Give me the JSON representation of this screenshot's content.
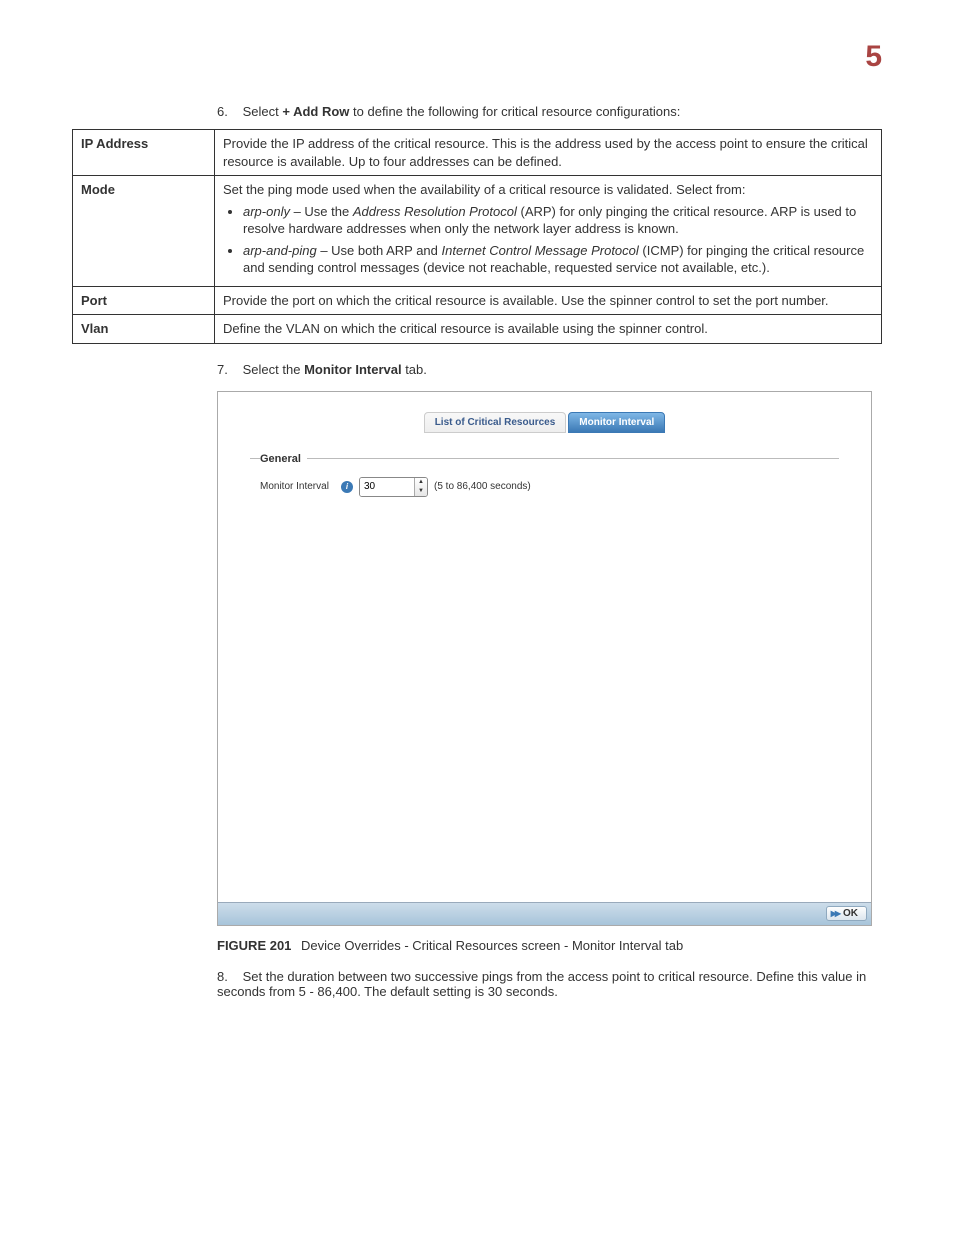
{
  "chapter": "5",
  "step6": {
    "num": "6.",
    "pre": "Select ",
    "bold": "+ Add Row",
    "post": " to define the following for critical resource configurations:"
  },
  "table": {
    "ip": {
      "label": "IP Address",
      "desc": "Provide the IP address of the critical resource. This is the address used by the access point to ensure the critical resource is available. Up to four addresses can be defined."
    },
    "mode": {
      "label": "Mode",
      "intro": "Set the ping mode used when the availability of a critical resource is validated. Select from:",
      "opt1_em": "arp-only",
      "opt1_mid": " – Use the ",
      "opt1_em2": "Address Resolution Protocol",
      "opt1_post": " (ARP) for only pinging the critical resource. ARP is used to resolve hardware addresses when only the network layer address is known.",
      "opt2_em": "arp-and-ping",
      "opt2_mid": " – Use both ARP and ",
      "opt2_em2": "Internet Control Message Protocol",
      "opt2_post": " (ICMP) for pinging the critical resource and sending control messages (device not reachable, requested service not available, etc.)."
    },
    "port": {
      "label": "Port",
      "desc": "Provide the port on which the critical resource is available. Use the spinner control to set the port number."
    },
    "vlan": {
      "label": "Vlan",
      "desc": "Define the VLAN on which the critical resource is available using the spinner control."
    }
  },
  "step7": {
    "num": "7.",
    "pre": "Select the ",
    "bold": "Monitor Interval",
    "post": " tab."
  },
  "panel": {
    "tab_list": "List of Critical Resources",
    "tab_monitor": "Monitor Interval",
    "legend": "General",
    "field_label": "Monitor Interval",
    "value": "30",
    "hint": "(5 to 86,400 seconds)",
    "ok": "OK"
  },
  "figure": {
    "label": "FIGURE 201",
    "caption": "Device Overrides - Critical Resources screen - Monitor Interval tab"
  },
  "step8": {
    "num": "8.",
    "text": "Set the duration between two successive pings from the access point to critical resource. Define this value in seconds from 5 - 86,400. The default setting is 30 seconds."
  }
}
